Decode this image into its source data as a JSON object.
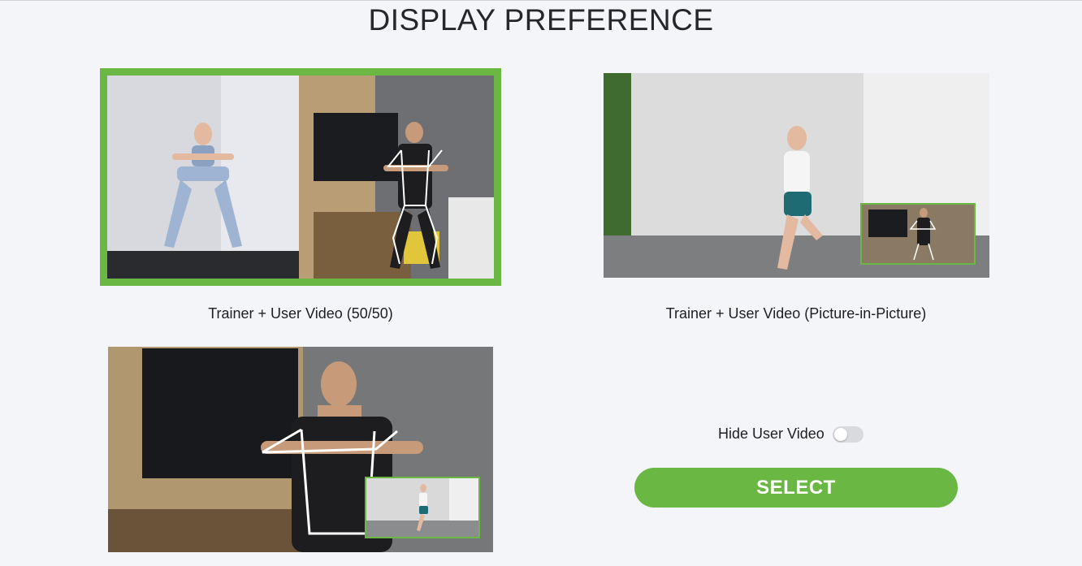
{
  "page": {
    "title": "DISPLAY PREFERENCE"
  },
  "options": [
    {
      "label": "Trainer + User Video (50/50)",
      "selected": true
    },
    {
      "label": "Trainer + User Video (Picture-in-Picture)",
      "selected": false
    },
    {
      "label": "",
      "selected": false
    }
  ],
  "hide_user_video": {
    "label": "Hide User Video",
    "enabled": false
  },
  "select_button": {
    "label": "SELECT"
  },
  "colors": {
    "accent": "#6ab843",
    "background": "#f4f5f9",
    "toggle_off": "#d9dadd"
  }
}
